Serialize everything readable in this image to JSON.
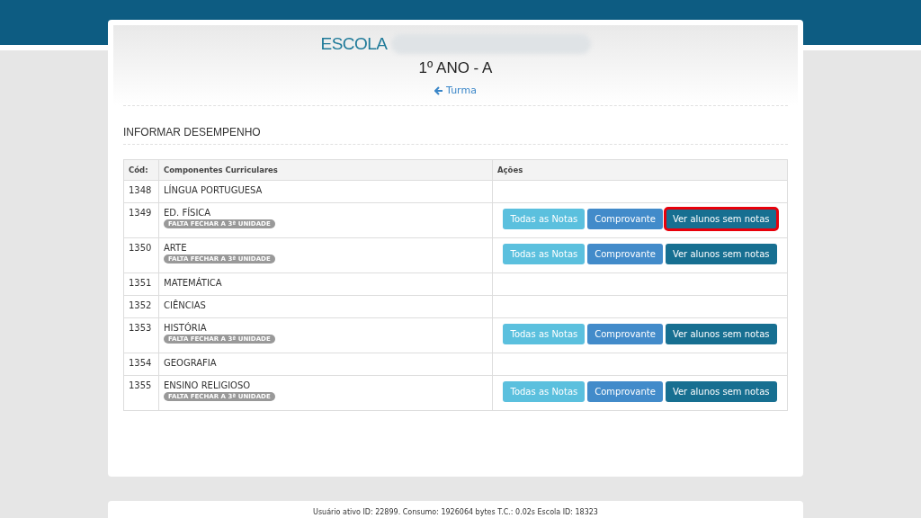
{
  "header": {
    "school_label": "ESCOLA",
    "class_title": "1º ANO - A",
    "back_link": "Turma"
  },
  "section_title": "INFORMAR DESEMPENHO",
  "table": {
    "columns": [
      "Cód:",
      "Componentes Curriculares",
      "Ações"
    ],
    "rows": [
      {
        "code": "1348",
        "name": "LÍNGUA PORTUGUESA",
        "actions": []
      },
      {
        "code": "1349",
        "name": "ED. FÍSICA",
        "badge": "FALTA FECHAR A 3ª UNIDADE",
        "actions": [
          {
            "kind": "info",
            "label": "Todas as Notas",
            "highlighted": false
          },
          {
            "kind": "primary",
            "label": "Comprovante",
            "highlighted": false
          },
          {
            "kind": "dark",
            "label": "Ver alunos sem notas",
            "highlighted": true
          }
        ]
      },
      {
        "code": "1350",
        "name": "ARTE",
        "badge": "FALTA FECHAR A 3ª UNIDADE",
        "actions": [
          {
            "kind": "info",
            "label": "Todas as Notas",
            "highlighted": false
          },
          {
            "kind": "primary",
            "label": "Comprovante",
            "highlighted": false
          },
          {
            "kind": "dark",
            "label": "Ver alunos sem notas",
            "highlighted": false
          }
        ]
      },
      {
        "code": "1351",
        "name": "MATEMÁTICA",
        "actions": []
      },
      {
        "code": "1352",
        "name": "CIÊNCIAS",
        "actions": []
      },
      {
        "code": "1353",
        "name": "HISTÓRIA",
        "badge": "FALTA FECHAR A 3ª UNIDADE",
        "actions": [
          {
            "kind": "info",
            "label": "Todas as Notas",
            "highlighted": false
          },
          {
            "kind": "primary",
            "label": "Comprovante",
            "highlighted": false
          },
          {
            "kind": "dark",
            "label": "Ver alunos sem notas",
            "highlighted": false
          }
        ]
      },
      {
        "code": "1354",
        "name": "GEOGRAFIA",
        "actions": []
      },
      {
        "code": "1355",
        "name": "ENSINO RELIGIOSO",
        "badge": "FALTA FECHAR A 3ª UNIDADE",
        "actions": [
          {
            "kind": "info",
            "label": "Todas as Notas",
            "highlighted": false
          },
          {
            "kind": "primary",
            "label": "Comprovante",
            "highlighted": false
          },
          {
            "kind": "dark",
            "label": "Ver alunos sem notas",
            "highlighted": false
          }
        ]
      }
    ]
  },
  "footer": "Usuário ativo ID: 22899. Consumo: 1926064 bytes T.C.: 0.02s Escola ID: 18323"
}
